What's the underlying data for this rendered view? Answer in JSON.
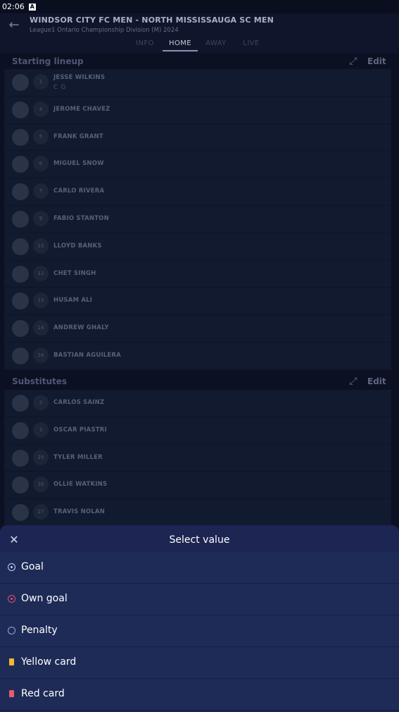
{
  "status": {
    "time": "02:06",
    "badge": "A"
  },
  "header": {
    "title": "WINDSOR CITY FC MEN - NORTH MISSISSAUGA SC MEN",
    "subtitle": "League1 Ontario Championship Division (M) 2024",
    "tabs": [
      {
        "label": "INFO"
      },
      {
        "label": "HOME"
      },
      {
        "label": "AWAY"
      },
      {
        "label": "LIVE"
      }
    ],
    "active_tab": "HOME"
  },
  "starting": {
    "title": "Starting lineup",
    "edit_label": "Edit",
    "players": [
      {
        "number": "1",
        "name": "JESSE WILKINS",
        "role": "C G"
      },
      {
        "number": "4",
        "name": "JEROME CHAVEZ"
      },
      {
        "number": "5",
        "name": "FRANK GRANT"
      },
      {
        "number": "6",
        "name": "MIGUEL SNOW"
      },
      {
        "number": "7",
        "name": "CARLO RIVERA"
      },
      {
        "number": "9",
        "name": "FABIO STANTON"
      },
      {
        "number": "10",
        "name": "LLOYD BANKS"
      },
      {
        "number": "12",
        "name": "CHET SINGH"
      },
      {
        "number": "13",
        "name": "HUSAM ALI"
      },
      {
        "number": "14",
        "name": "ANDREW GHALY"
      },
      {
        "number": "24",
        "name": "BASTIAN AGUILERA"
      }
    ]
  },
  "subs": {
    "title": "Substitutes",
    "edit_label": "Edit",
    "players": [
      {
        "number": "2",
        "name": "CARLOS SAINZ"
      },
      {
        "number": "3",
        "name": "OSCAR PIASTRI"
      },
      {
        "number": "25",
        "name": "TYLER MILLER"
      },
      {
        "number": "26",
        "name": "OLLIE WATKINS"
      },
      {
        "number": "27",
        "name": "TRAVIS NOLAN"
      }
    ]
  },
  "sheet": {
    "title": "Select value",
    "options": [
      {
        "label": "Goal",
        "icon": "soccer-ball-icon",
        "color": "#c8cdf5"
      },
      {
        "label": "Own goal",
        "icon": "own-goal-ball-icon",
        "color": "#e0506a"
      },
      {
        "label": "Penalty",
        "icon": "penalty-icon",
        "color": "#9aa2d6"
      },
      {
        "label": "Yellow card",
        "icon": "yellow-card-icon",
        "color": "#f5b82e"
      },
      {
        "label": "Red card",
        "icon": "red-card-icon",
        "color": "#e85a6e"
      }
    ]
  }
}
